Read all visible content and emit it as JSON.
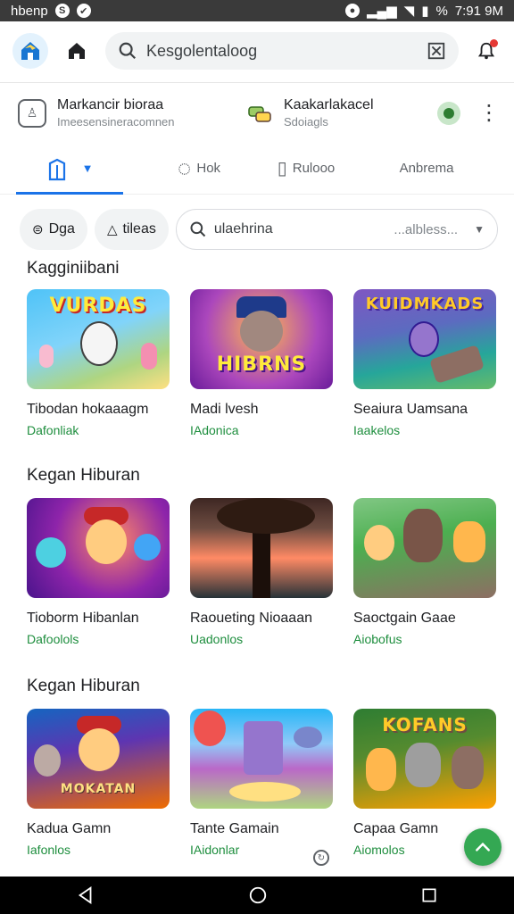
{
  "status_bar": {
    "carrier": "hbenp",
    "time": "7:91 9M",
    "battery_pct": "%"
  },
  "top_bar": {
    "search_text": "Kesgolentaloog"
  },
  "account": {
    "left_title": "Markancir bioraa",
    "left_sub": "Imeesensineracomnen",
    "right_title": "Kaakarlakacel",
    "right_sub": "Sdoiagls"
  },
  "tabs": [
    {
      "label": ""
    },
    {
      "label": "Hok"
    },
    {
      "label": "Rulooo"
    },
    {
      "label": "Anbrema"
    }
  ],
  "filters": {
    "chip1": "Dga",
    "chip2": "tileas",
    "select_text": "ulaehrina",
    "select_hint": "...albless..."
  },
  "sections": [
    {
      "title": "Kagginiibani",
      "cards": [
        {
          "name": "Tibodan hokaaagm",
          "sub": "Dafonliak",
          "thumb_text": "VURDAS",
          "colors": [
            "#4fc3f7",
            "#ffe082"
          ]
        },
        {
          "name": "Madi lvesh",
          "sub": "IAdonica",
          "thumb_text": "HIBRNS",
          "colors": [
            "#ab47bc",
            "#ff7043"
          ]
        },
        {
          "name": "Seaiura Uamsana",
          "sub": "Iaakelos",
          "thumb_text": "KUIDMKADS",
          "colors": [
            "#7e57c2",
            "#26a69a"
          ]
        }
      ]
    },
    {
      "title": "Kegan Hiburan",
      "cards": [
        {
          "name": "Tioborm Hibanlan",
          "sub": "Dafoolols",
          "thumb_text": "",
          "colors": [
            "#8e24aa",
            "#ff8a65"
          ]
        },
        {
          "name": "Raoueting Nioaaan",
          "sub": "Uadonlos",
          "thumb_text": "",
          "colors": [
            "#3e2723",
            "#ff8a65"
          ]
        },
        {
          "name": "Saoctgain Gaae",
          "sub": "Aiobofus",
          "thumb_text": "",
          "colors": [
            "#66bb6a",
            "#8d6e63"
          ]
        }
      ]
    },
    {
      "title": "Kegan Hiburan",
      "cards": [
        {
          "name": "Kadua Gamn",
          "sub": "Iafonlos",
          "thumb_text": "MOKATAN",
          "colors": [
            "#1565c0",
            "#ef6c00"
          ]
        },
        {
          "name": "Tante Gamain",
          "sub": "IAidonlar",
          "thumb_text": "",
          "colors": [
            "#29b6f6",
            "#ba68c8"
          ]
        },
        {
          "name": "Capaa Gamn",
          "sub": "Aiomolos",
          "thumb_text": "KOFANS",
          "colors": [
            "#2e7d32",
            "#ffa000"
          ]
        }
      ]
    }
  ],
  "icons": {
    "logo": "app-logo-icon",
    "home": "home-icon",
    "search": "search-icon",
    "clear": "close-box-icon",
    "notif": "bell-icon",
    "fab": "arrow-up-icon"
  }
}
